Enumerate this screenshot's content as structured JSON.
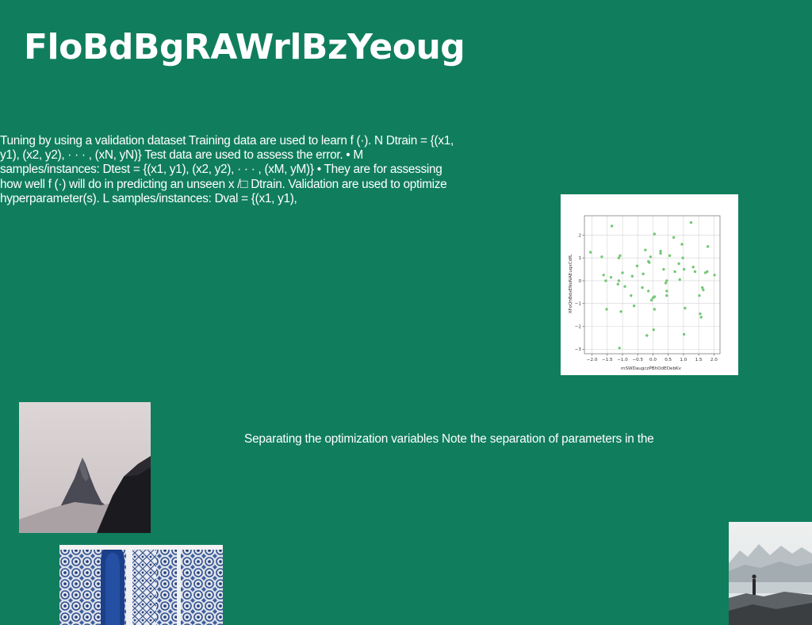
{
  "page": {
    "title": "FloBdBgRAWrlBzYeoug",
    "body_text": "Tuning by using a validation dataset Training data are used to learn f (·). N Dtrain = {(x1, y1), (x2, y2), · · · , (xN, yN)} Test data are used to assess the error. • M samples/instances: Dtest = {(x1, y1), (x2, y2), · · · , (xM, yM)} • They are for assessing how well f (·) will do in predicting an unseen x /□ Dtrain. Validation are used to optimize hyperparameter(s). L samples/instances: Dval = {(x1, y1),",
    "caption": "Separating the optimization variables Note the separation of parameters in the",
    "background_color": "#107e5c"
  },
  "images": {
    "mountain": "photo of a dark mountain peak against a pale sky",
    "tiles": "photo of a blue and white mosaic tiled wall with an arched doorway",
    "coast": "photo of a person standing on rocks by the sea with hazy mountains"
  },
  "chart_data": {
    "type": "scatter",
    "xlabel": "mSWDaugczPBhOdEOebKv",
    "ylabel": "XFoQhBdxENoNAEuqxCdfL",
    "xlim": [
      -2.25,
      2.2
    ],
    "ylim": [
      -3.2,
      2.85
    ],
    "xticks": [
      -2.0,
      -1.5,
      -1.0,
      -0.5,
      0.0,
      0.5,
      1.0,
      1.5,
      2.0
    ],
    "xtick_labels": [
      "−2.0",
      "−1.5",
      "−1.0",
      "−0.5",
      "0.0",
      "0.5",
      "1.0",
      "1.5",
      "2.0"
    ],
    "yticks": [
      -3,
      -2,
      -1,
      0,
      1,
      2
    ],
    "ytick_labels": [
      "−3",
      "−2",
      "−1",
      "0",
      "1",
      "2"
    ],
    "grid": true,
    "point_color": "#76c776",
    "points": [
      [
        -2.05,
        1.25
      ],
      [
        -1.68,
        1.05
      ],
      [
        -1.62,
        0.25
      ],
      [
        -1.55,
        0.0
      ],
      [
        -1.52,
        -1.25
      ],
      [
        -1.35,
        2.4
      ],
      [
        -1.38,
        0.15
      ],
      [
        -1.12,
        1.0
      ],
      [
        -1.08,
        1.1
      ],
      [
        -1.12,
        0.0
      ],
      [
        -1.15,
        -0.15
      ],
      [
        -1.0,
        0.35
      ],
      [
        -0.92,
        -0.25
      ],
      [
        -1.05,
        -1.35
      ],
      [
        -1.1,
        -2.95
      ],
      [
        -0.72,
        -0.65
      ],
      [
        -0.68,
        0.2
      ],
      [
        -0.62,
        -1.1
      ],
      [
        -0.52,
        0.65
      ],
      [
        -0.32,
        0.3
      ],
      [
        -0.35,
        -0.3
      ],
      [
        -0.25,
        1.35
      ],
      [
        -0.15,
        0.85
      ],
      [
        -0.12,
        0.8
      ],
      [
        -0.08,
        1.05
      ],
      [
        -0.15,
        -0.45
      ],
      [
        -0.2,
        -2.4
      ],
      [
        -0.05,
        -0.85
      ],
      [
        0.05,
        -0.7
      ],
      [
        0.0,
        -0.75
      ],
      [
        0.05,
        -1.25
      ],
      [
        0.02,
        -2.15
      ],
      [
        0.05,
        2.05
      ],
      [
        0.25,
        1.3
      ],
      [
        0.25,
        1.2
      ],
      [
        0.35,
        0.5
      ],
      [
        0.45,
        0.0
      ],
      [
        0.42,
        -0.1
      ],
      [
        0.45,
        -0.45
      ],
      [
        0.45,
        -0.65
      ],
      [
        0.55,
        1.1
      ],
      [
        0.68,
        1.9
      ],
      [
        0.72,
        0.4
      ],
      [
        0.85,
        0.75
      ],
      [
        0.88,
        0.05
      ],
      [
        0.95,
        1.6
      ],
      [
        0.98,
        1.0
      ],
      [
        1.02,
        0.5
      ],
      [
        1.05,
        -1.2
      ],
      [
        1.02,
        -2.35
      ],
      [
        1.25,
        2.55
      ],
      [
        1.32,
        0.6
      ],
      [
        1.38,
        0.4
      ],
      [
        1.52,
        -0.65
      ],
      [
        1.55,
        -1.45
      ],
      [
        1.58,
        -1.6
      ],
      [
        1.62,
        -0.3
      ],
      [
        1.65,
        -0.4
      ],
      [
        1.72,
        0.35
      ],
      [
        1.78,
        0.4
      ],
      [
        1.8,
        1.5
      ],
      [
        2.02,
        0.25
      ]
    ]
  }
}
